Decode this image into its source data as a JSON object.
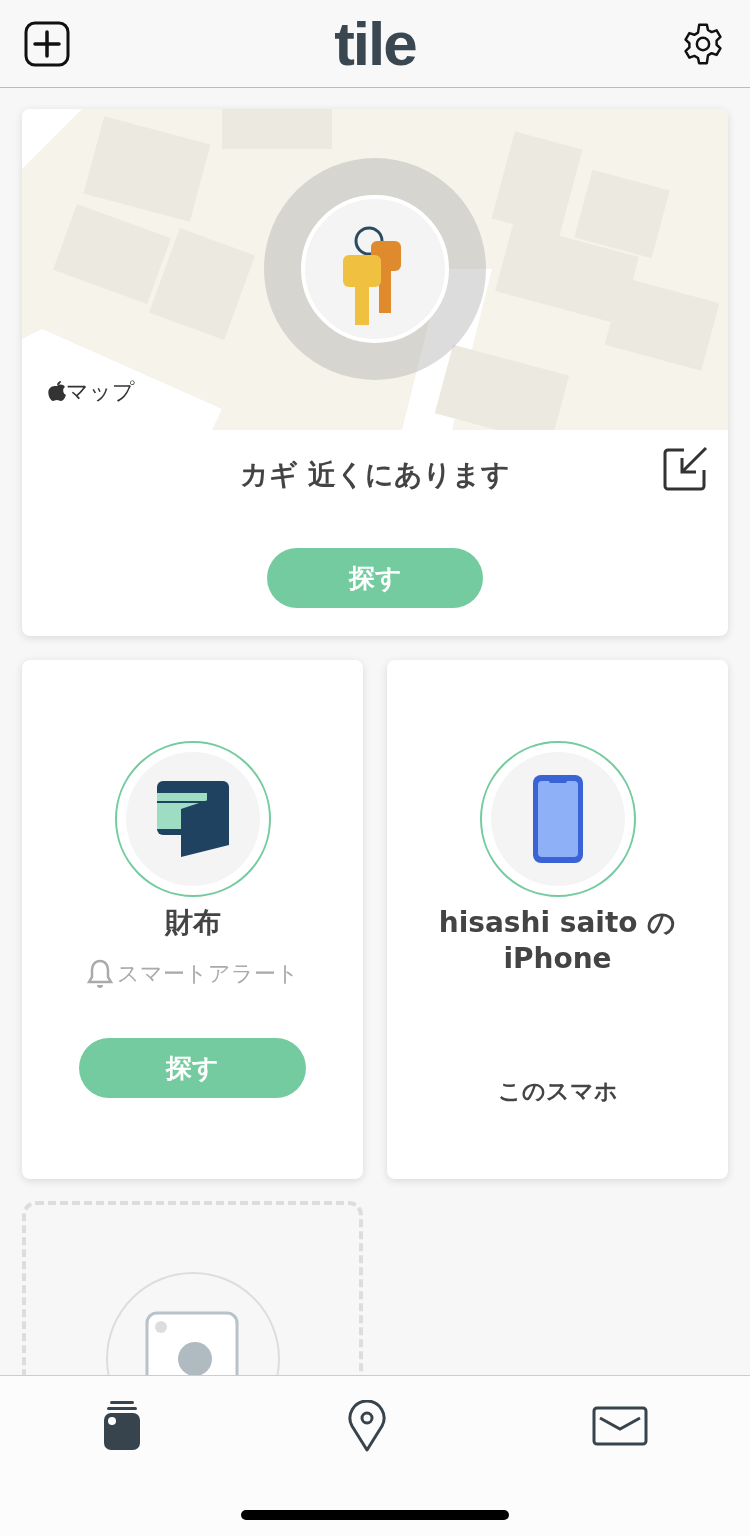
{
  "header": {
    "logo": "tile"
  },
  "featured": {
    "title": "カギ 近くにあります",
    "map_label": "マップ",
    "action": "探す"
  },
  "devices": [
    {
      "kind": "tile",
      "name": "財布",
      "alert": "スマートアラート",
      "action": "探す"
    },
    {
      "kind": "phone",
      "name": "hisashi saito の iPhone",
      "note": "このスマホ"
    }
  ],
  "tabs": [
    {
      "kind": "items",
      "selected": true
    },
    {
      "kind": "map",
      "selected": false
    },
    {
      "kind": "inbox",
      "selected": false
    }
  ]
}
